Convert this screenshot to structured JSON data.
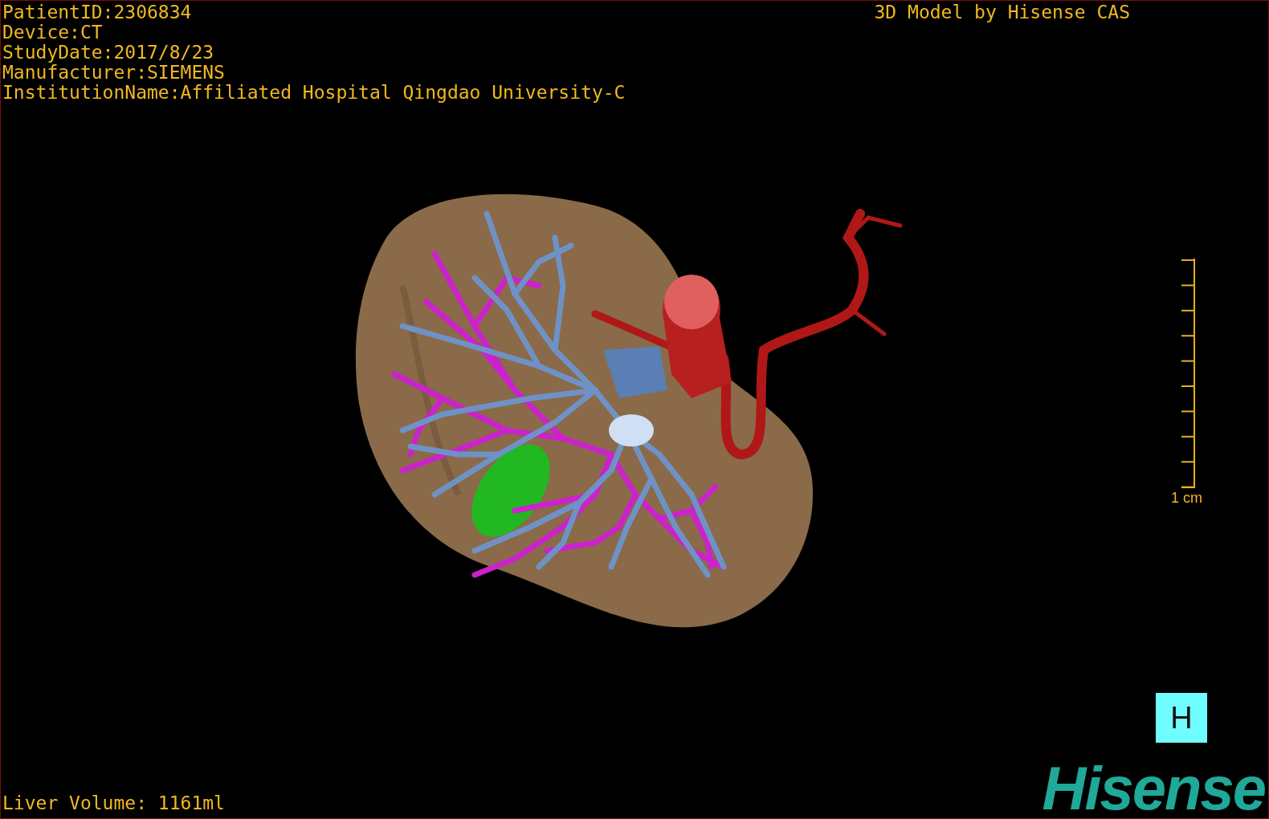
{
  "overlay_info": [
    "PatientID:2306834",
    "Device:CT",
    "StudyDate:2017/8/23",
    "Manufacturer:SIEMENS",
    "InstitutionName:Affiliated Hospital Qingdao University-C"
  ],
  "model_credit": "3D Model by Hisense CAS",
  "scale_bar": {
    "label": "1 cm"
  },
  "orientation_marker": "H",
  "liver_volume": "Liver Volume: 1161ml",
  "logo": "Hisense"
}
